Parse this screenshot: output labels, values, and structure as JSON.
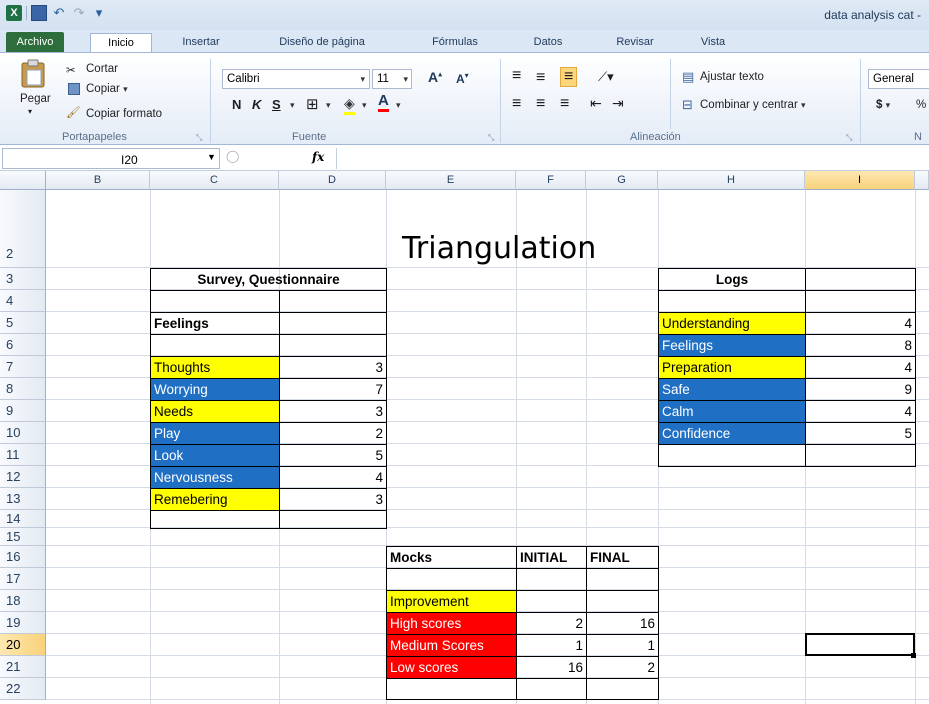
{
  "window": {
    "title": "data analysis cat -"
  },
  "ribbon": {
    "tabs": [
      "Archivo",
      "Inicio",
      "Insertar",
      "Diseño de página",
      "Fórmulas",
      "Datos",
      "Revisar",
      "Vista"
    ],
    "clipboard": {
      "cut": "Cortar",
      "copy": "Copiar",
      "format_painter": "Copiar formato",
      "paste": "Pegar",
      "label": "Portapapeles"
    },
    "font": {
      "name": "Calibri",
      "size": "11",
      "label": "Fuente",
      "bold": "N",
      "italic": "K",
      "underline": "S"
    },
    "alignment": {
      "wrap": "Ajustar texto",
      "merge": "Combinar y centrar",
      "label": "Alineación"
    },
    "number": {
      "format": "General",
      "currency": "$",
      "percent": "%",
      "label": "N"
    }
  },
  "formula_bar": {
    "namebox": "I20",
    "fx": "fx",
    "value": ""
  },
  "columns": [
    "B",
    "C",
    "D",
    "E",
    "F",
    "G",
    "H",
    "I"
  ],
  "selected_column": "I",
  "rows": [
    "2",
    "3",
    "4",
    "5",
    "6",
    "7",
    "8",
    "9",
    "10",
    "11",
    "12",
    "13",
    "14",
    "15",
    "16",
    "17",
    "18",
    "19",
    "20",
    "21",
    "22"
  ],
  "selected_row": "20",
  "sheet": {
    "title": "Triangulation",
    "survey": {
      "header": "Survey, Questionnaire",
      "section": "Feelings",
      "items": [
        {
          "label": "Thoughts",
          "value": "3",
          "color": "#ffff00"
        },
        {
          "label": "Worrying",
          "value": "7",
          "color": "#1f6fc5"
        },
        {
          "label": "Needs",
          "value": "3",
          "color": "#ffff00"
        },
        {
          "label": "Play",
          "value": "2",
          "color": "#1f6fc5"
        },
        {
          "label": "Look",
          "value": "5",
          "color": "#1f6fc5"
        },
        {
          "label": "Nervousness",
          "value": "4",
          "color": "#1f6fc5"
        },
        {
          "label": "Remebering",
          "value": "3",
          "color": "#ffff00"
        }
      ]
    },
    "logs": {
      "header": "Logs",
      "items": [
        {
          "label": "Understanding",
          "value": "4",
          "color": "#ffff00"
        },
        {
          "label": "Feelings",
          "value": "8",
          "color": "#1f6fc5"
        },
        {
          "label": "Preparation",
          "value": "4",
          "color": "#ffff00"
        },
        {
          "label": "Safe",
          "value": "9",
          "color": "#1f6fc5"
        },
        {
          "label": "Calm",
          "value": "4",
          "color": "#1f6fc5"
        },
        {
          "label": "Confidence",
          "value": "5",
          "color": "#1f6fc5"
        }
      ]
    },
    "mocks": {
      "header": "Mocks",
      "col1": "INITIAL",
      "col2": "FINAL",
      "improvement": "Improvement",
      "rows": [
        {
          "label": "High scores",
          "initial": "2",
          "final": "16"
        },
        {
          "label": "Medium Scores",
          "initial": "1",
          "final": "1"
        },
        {
          "label": "Low scores",
          "initial": "16",
          "final": "2"
        }
      ]
    }
  }
}
